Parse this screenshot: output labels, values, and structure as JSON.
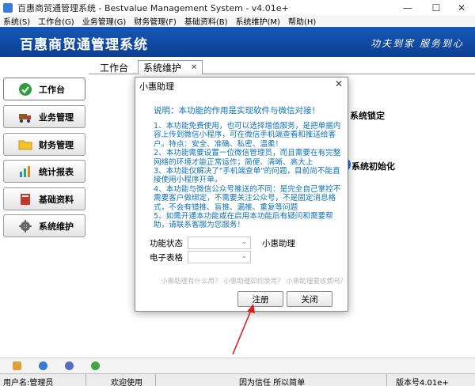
{
  "window": {
    "title": "百惠商贸通管理系统 - Bestvalue Management System - v4.01e+",
    "controls": {
      "minimize": "—",
      "maximize": "☐",
      "close": "✕"
    }
  },
  "menubar": {
    "items": [
      "系统(S)",
      "工作台(G)",
      "业务管理(G)",
      "财务管理(F)",
      "基础资料(B)",
      "系统维护(M)",
      "帮助(H)"
    ]
  },
  "banner": {
    "title": "百惠商贸通管理系统",
    "slogan": "功夫到家 服务到心"
  },
  "sidebar": {
    "items": [
      {
        "label": "工作台",
        "icon": "check-icon"
      },
      {
        "label": "业务管理",
        "icon": "truck-icon"
      },
      {
        "label": "财务管理",
        "icon": "folder-icon"
      },
      {
        "label": "统计报表",
        "icon": "bar-chart-icon"
      },
      {
        "label": "基础资料",
        "icon": "book-icon"
      },
      {
        "label": "系统维护",
        "icon": "gear-icon"
      }
    ]
  },
  "tabs": [
    {
      "label": "工作台"
    },
    {
      "label": "系统维护",
      "close": "✕"
    }
  ],
  "background_features": {
    "lock_label": "系统锁定",
    "init_label": "系统初始化"
  },
  "dialog": {
    "title": "小惠助理",
    "close": "✕",
    "heading": "说明：本功能的作用是实现软件与微信对接！",
    "items": [
      "1、本功能免费使用，也可以选择增值服务，是把单据内容上传到微信小程序，可在微信手机端查看和推送给客户。特点：安全、准确、私密、温柔！",
      "2、本功能需要设置一位微信管理员，而且需要在有完整网络的环境才能正常运作；简便、清晰、高大上",
      "3、本功能仅解决了\"手机端查单\"的问题，目前尚不能直接使用小程序开单。",
      "4、本功能与微信公众号推送的不同：是完全自己掌控不需要客户做绑定，不需要关注公众号，不是固定消息格式，不会有错推、盲推、漏推、重复等问题",
      "5、如需开通本功能或在启用本功能后有疑问和需要帮助，请联系客服为您服务！"
    ],
    "status_label": "功能状态",
    "status_value": "",
    "helper_label": "小惠助理",
    "sheet_label": "电子表格",
    "sheet_value": "",
    "links": "小惠助理有什么用？ 小惠助理如何使用？ 小惠助理要收费吗？",
    "register_button": "注册",
    "close_button": "关闭"
  },
  "statusbar": {
    "user": "用户名:管理员",
    "welcome": "欢迎使用",
    "motto": "因为信任 所以简单",
    "version": "版本号4.01e+"
  },
  "colors": {
    "banner": "#1557b8",
    "dialog_text": "#0e73b8",
    "arrow": "#d81e1e"
  }
}
